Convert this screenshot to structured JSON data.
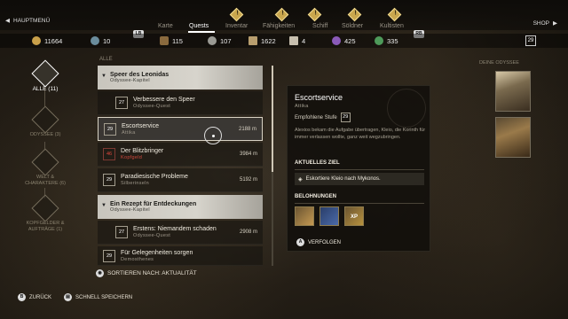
{
  "nav": {
    "hauptmenu": "HAUPTMENÜ",
    "lb": "LB",
    "rb": "RB",
    "shop": "SHOP",
    "tabs": [
      "Karte",
      "Quests",
      "Inventar",
      "Fähigkeiten",
      "Schiff",
      "Söldner",
      "Kultisten"
    ]
  },
  "resources": {
    "drachmen": "11664",
    "item2": "10",
    "wood": "115",
    "leather": "107",
    "metal": "1622",
    "fabric": "4",
    "crystals": "425",
    "herbs": "335",
    "level": "29"
  },
  "sidebar": {
    "items": [
      {
        "label": "ALLE (11)"
      },
      {
        "label": "ODYSSEE (3)"
      },
      {
        "label": "WELT & CHARAKTERE (6)"
      },
      {
        "label": "KOPFGELDER & AUFTRÄGE (1)"
      }
    ]
  },
  "list": {
    "header": "ALLE",
    "rows": [
      {
        "title": "Speer des Leonidas",
        "sub": "Odyssee-Kapitel"
      },
      {
        "level": "27",
        "title": "Verbessere den Speer",
        "sub": "Odyssee-Quest",
        "dist": ""
      },
      {
        "level": "29",
        "title": "Escortservice",
        "sub": "Attika",
        "dist": "2188 m"
      },
      {
        "level": "46",
        "title": "Der Blitzbringer",
        "sub": "Kopfgeld",
        "dist": "3984 m"
      },
      {
        "level": "29",
        "title": "Paradiesische Probleme",
        "sub": "Silberinseln",
        "dist": "5192 m"
      },
      {
        "title": "Ein Rezept für Entdeckungen",
        "sub": "Odyssee-Kapitel"
      },
      {
        "level": "27",
        "title": "Erstens: Niemandem schaden",
        "sub": "Odyssee-Quest",
        "dist": "2908 m"
      },
      {
        "level": "29",
        "title": "Für Gelegenheiten sorgen",
        "sub": "Demosthenes",
        "dist": ""
      }
    ],
    "sort": "SORTIEREN NACH: AKTUALITÄT"
  },
  "detail": {
    "title": "Escortservice",
    "region": "Attika",
    "stufe_label": "Empfohlene Stufe",
    "stufe": "29",
    "desc": "Alexios bekam die Aufgabe übertragen, Kleio, die Korinth für immer verlassen wollte, ganz weit wegzubringen.",
    "goal_header": "AKTUELLES ZIEL",
    "goal": "Eskortiere Kleio nach Mykonos.",
    "reward_header": "BELOHNUNGEN",
    "reward_xp": "XP",
    "follow": "VERFOLGEN"
  },
  "odyssey": {
    "label": "DEINE ODYSSEE"
  },
  "bottom": {
    "back": "ZURÜCK",
    "save": "SCHNELL SPEICHERN"
  }
}
